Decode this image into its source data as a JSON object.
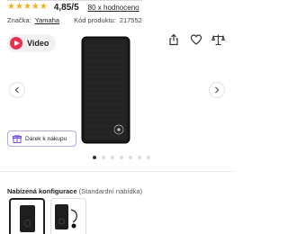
{
  "rating": {
    "stars": [
      "★",
      "★",
      "★",
      "★",
      "★"
    ],
    "value": "4,85/5",
    "reviews_link": "80 x hodnoceno"
  },
  "meta": {
    "brand_label": "Značka:",
    "brand_value": "Yamaha",
    "code_label": "Kód produktu:",
    "code_value": "217552"
  },
  "video_button": {
    "label": "Video"
  },
  "action_icons": [
    "share-icon",
    "heart-icon",
    "compare-scale-icon"
  ],
  "gallery": {
    "dots_count": 7,
    "active_index": 0
  },
  "gift_button": {
    "label": "Dárek k nákupu"
  },
  "configuration": {
    "title": "Nabízená konfigurace",
    "subtitle": "(Standardní nabídka)"
  },
  "colors": {
    "star": "#f2b01e",
    "video_play": "#e8304f",
    "gift_border": "#b8a6e6",
    "gift_icon": "#7a4fd6"
  }
}
